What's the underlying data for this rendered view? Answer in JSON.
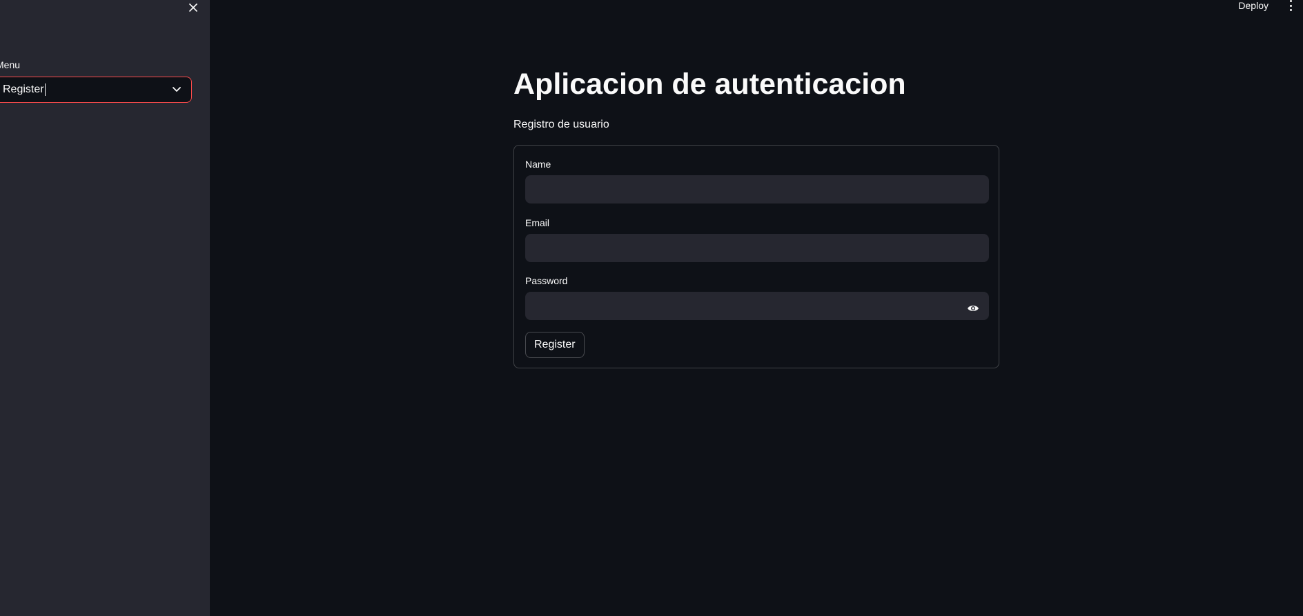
{
  "sidebar": {
    "menu_label": "Menu",
    "select": {
      "value": "Register"
    }
  },
  "header": {
    "deploy_label": "Deploy"
  },
  "main": {
    "title": "Aplicacion de autenticacion",
    "subtitle": "Registro de usuario",
    "form": {
      "name_label": "Name",
      "name_value": "",
      "email_label": "Email",
      "email_value": "",
      "password_label": "Password",
      "password_value": "",
      "submit_label": "Register"
    }
  },
  "colors": {
    "background": "#0e1117",
    "sidebar": "#262730",
    "accent": "#ff4b4b",
    "input": "#262730",
    "text": "#fafafa"
  },
  "icons": [
    "close-icon",
    "chevron-down-icon",
    "more-vertical-icon",
    "eye-icon"
  ]
}
